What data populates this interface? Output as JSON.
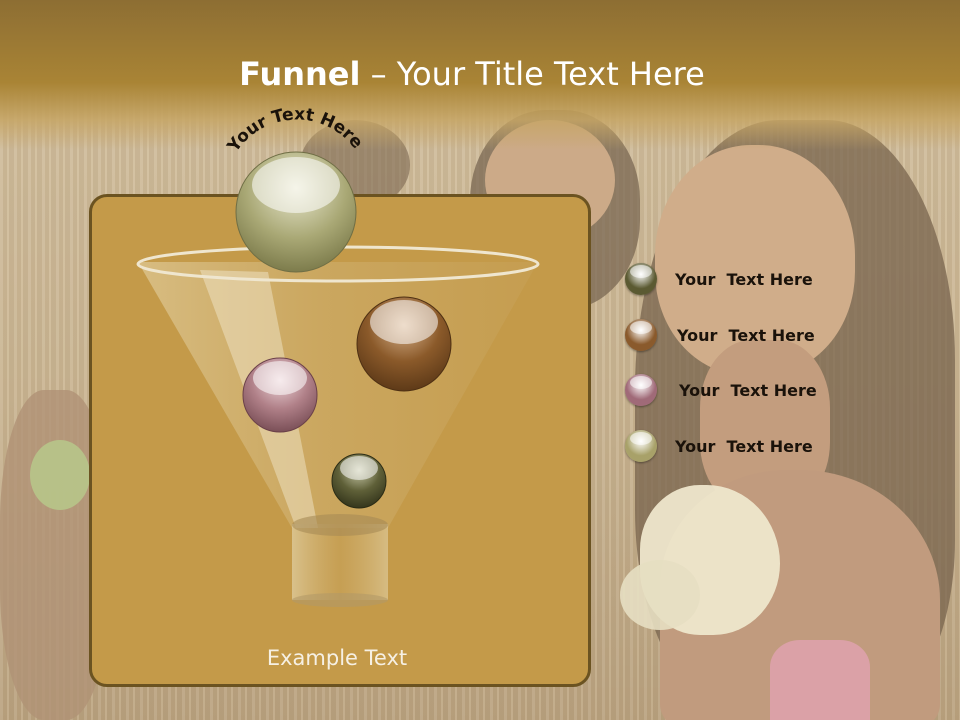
{
  "slide": {
    "title_bold": "Funnel",
    "title_rest": " – Your Title Text Here",
    "arc_text": "Your Text Here",
    "example_text": "Example Text"
  },
  "legend": [
    {
      "label": "Your  Text Here",
      "color": "#5b5a32"
    },
    {
      "label": "Your  Text Here",
      "color": "#8a5a2c"
    },
    {
      "label": "Your  Text Here",
      "color": "#a06a78"
    },
    {
      "label": "Your  Text Here",
      "color": "#a8a169"
    }
  ],
  "colors": {
    "panel": "#c49a49",
    "panel_border": "#6b5321",
    "header": "#a98435"
  }
}
